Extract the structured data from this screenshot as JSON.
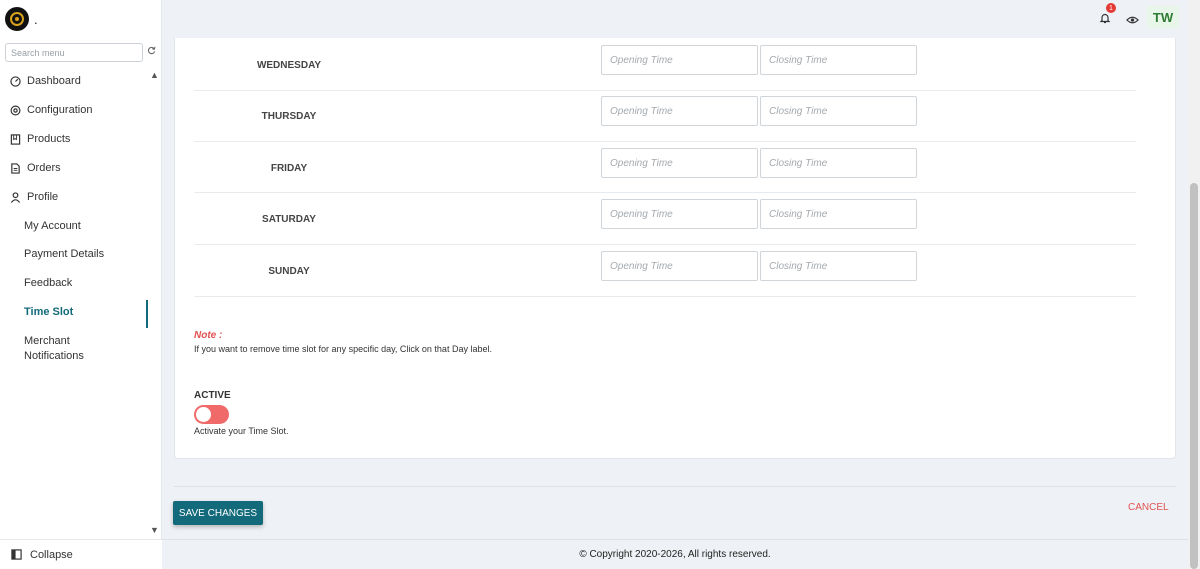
{
  "brand": {
    "name": "."
  },
  "sidebar": {
    "search_placeholder": "Search menu",
    "items": [
      {
        "label": "Dashboard",
        "icon": "dashboard-icon"
      },
      {
        "label": "Configuration",
        "icon": "gear-icon"
      },
      {
        "label": "Products",
        "icon": "book-icon"
      },
      {
        "label": "Orders",
        "icon": "document-icon"
      },
      {
        "label": "Profile",
        "icon": "user-icon"
      }
    ],
    "sub_items": [
      {
        "label": "My Account"
      },
      {
        "label": "Payment Details"
      },
      {
        "label": "Feedback"
      },
      {
        "label": "Time Slot",
        "active": true
      },
      {
        "label": "Merchant Notifications"
      }
    ],
    "collapse_label": "Collapse"
  },
  "header": {
    "notification_count": "1",
    "avatar_initials": "TW"
  },
  "schedule": {
    "opening_placeholder": "Opening Time",
    "closing_placeholder": "Closing Time",
    "days": [
      "WEDNESDAY",
      "THURSDAY",
      "FRIDAY",
      "SATURDAY",
      "SUNDAY"
    ]
  },
  "note": {
    "title": "Note :",
    "text": "If you want to remove time slot for any specific day, Click on that Day label."
  },
  "active": {
    "label": "ACTIVE",
    "help": "Activate your Time Slot.",
    "enabled": false
  },
  "actions": {
    "save_label": "SAVE CHANGES",
    "cancel_label": "CANCEL"
  },
  "footer": {
    "copyright": "© Copyright 2020-2026, All rights reserved."
  },
  "colors": {
    "primary": "#126a7a",
    "danger": "#e35252",
    "toggle_off": "#f16a6a"
  }
}
